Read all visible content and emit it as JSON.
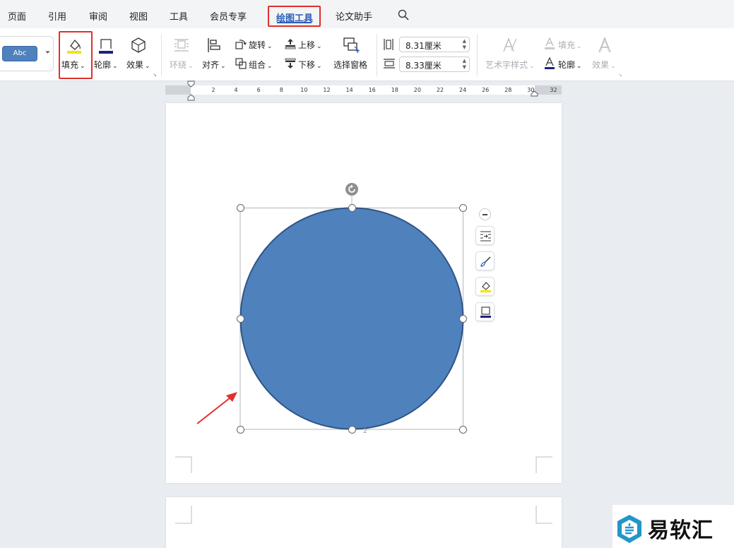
{
  "menu": {
    "items": [
      "页面",
      "引用",
      "审阅",
      "视图",
      "工具",
      "会员专享"
    ],
    "active_tab": "绘图工具",
    "after_active": "论文助手"
  },
  "ribbon": {
    "style_sample": "Abc",
    "fill_label": "填充",
    "outline_label": "轮廓",
    "effect_label": "效果",
    "wrap_label": "环绕",
    "align_label": "对齐",
    "rotate_label": "旋转",
    "group_label": "组合",
    "bring_forward_label": "上移",
    "send_backward_label": "下移",
    "selection_pane_label": "选择窗格",
    "height_value": "8.31厘米",
    "width_value": "8.33厘米",
    "art_text_label": "艺术字样式",
    "text_fill_label": "填充",
    "text_outline_label": "轮廓",
    "text_effect_label": "效果"
  },
  "ruler": {
    "ticks": [
      "2",
      "4",
      "6",
      "8",
      "10",
      "12",
      "14",
      "16",
      "18",
      "20",
      "22",
      "24",
      "26",
      "28",
      "30",
      "32"
    ]
  },
  "canvas": {
    "shape_fill": "#4f81bd",
    "shape_stroke": "#2f5585",
    "page_marker": "2"
  },
  "colors": {
    "accent": "#2b5fb8",
    "highlight_box": "#e0302c",
    "fill_swatch": "#f5e400",
    "outline_swatch": "#1a237e"
  },
  "watermark": {
    "text": "易软汇"
  }
}
